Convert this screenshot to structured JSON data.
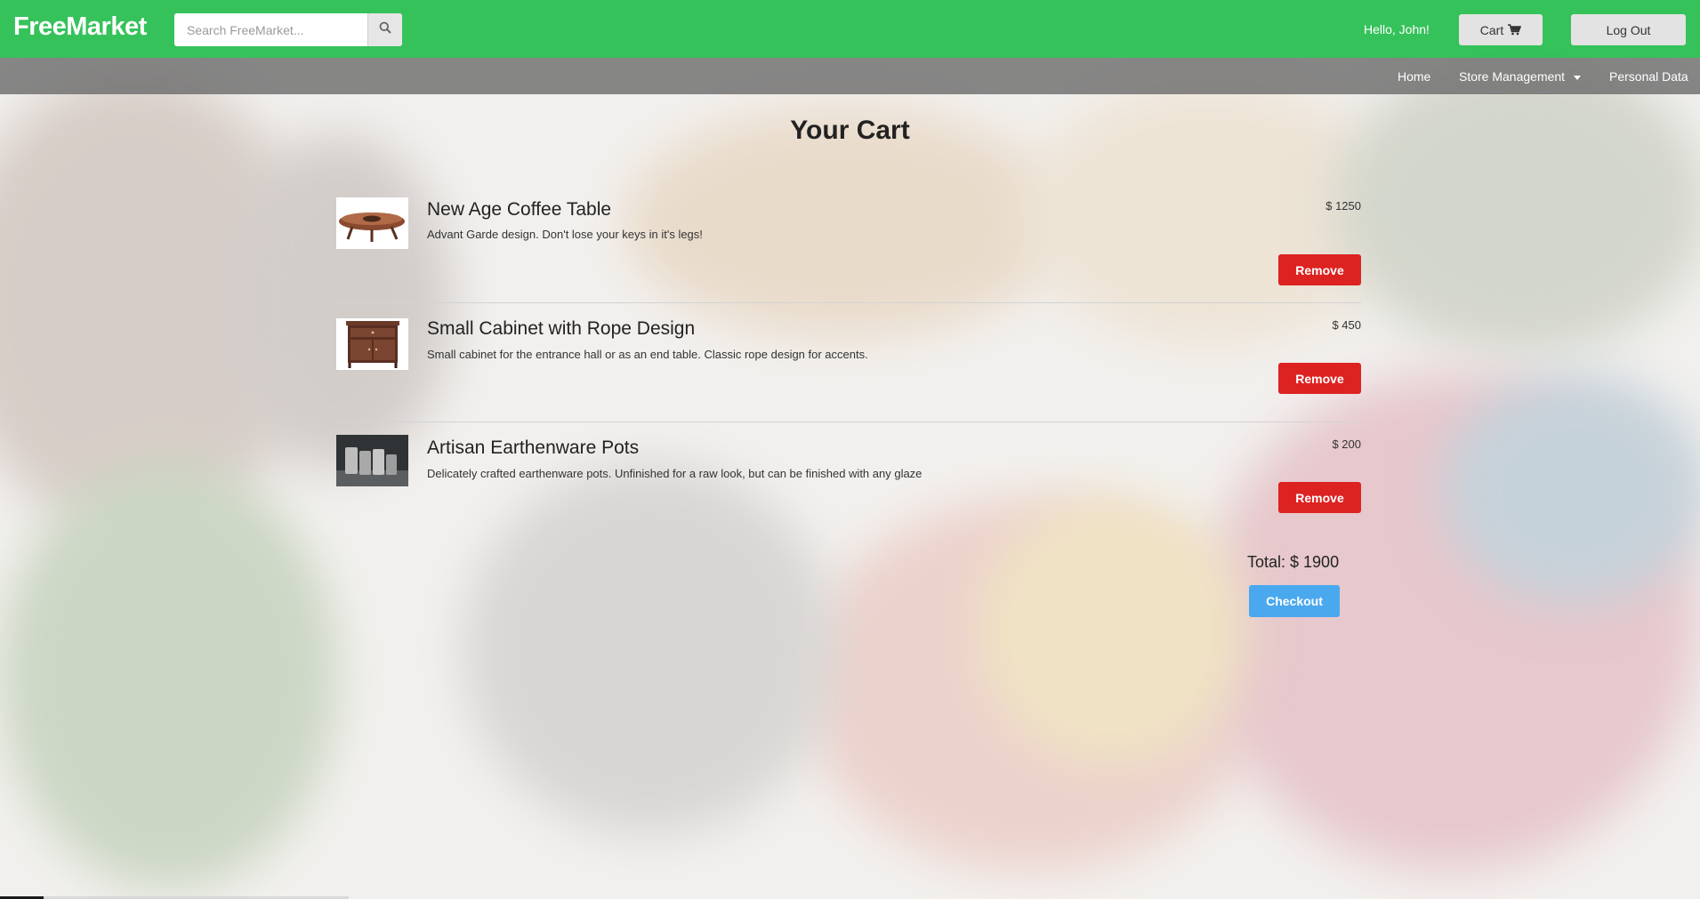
{
  "app": {
    "brand": "FreeMarket"
  },
  "header": {
    "search_placeholder": "Search FreeMarket...",
    "search_icon": "search-icon",
    "greeting": "Hello, John!",
    "cart_label": "Cart",
    "cart_icon": "shopping-cart-icon",
    "logout_label": "Log Out"
  },
  "nav": {
    "items": [
      {
        "label": "Home"
      },
      {
        "label": "Store Management",
        "has_dropdown": true
      },
      {
        "label": "Personal Data"
      }
    ]
  },
  "cart": {
    "title": "Your Cart",
    "items": [
      {
        "name": "New Age Coffee Table",
        "description": "Advant Garde design. Don't lose your keys in it's legs!",
        "price": "$ 1250",
        "remove_label": "Remove"
      },
      {
        "name": "Small Cabinet with Rope Design",
        "description": "Small cabinet for the entrance hall or as an end table. Classic rope design for accents.",
        "price": "$ 450",
        "remove_label": "Remove"
      },
      {
        "name": "Artisan Earthenware Pots",
        "description": "Delicately crafted earthenware pots. Unfinished for a raw look, but can be finished with any glaze",
        "price": "$ 200",
        "remove_label": "Remove"
      }
    ],
    "total": "Total: $ 1900",
    "checkout_label": "Checkout"
  },
  "colors": {
    "topbar": "#28be50",
    "remove": "#dd2222",
    "checkout": "#4aa8ef"
  }
}
